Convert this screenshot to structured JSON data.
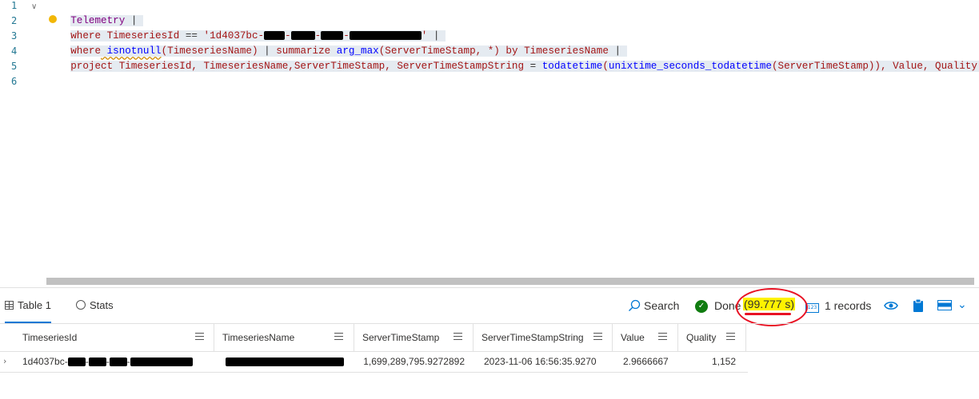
{
  "editor": {
    "line_numbers": [
      "1",
      "2",
      "3",
      "4",
      "5",
      "6"
    ],
    "lines": {
      "l1_table": "Telemetry",
      "l1_pipe": " |",
      "l2_where": "where",
      "l2_field": " TimeseriesId",
      "l2_op": " ==",
      "l2_str_start": " '1d4037bc-",
      "l2_str_end": "'",
      "l2_pipe": " |",
      "l3_where": "where",
      "l3_fn": " isnotnull",
      "l3_arg": "(TimeseriesName)",
      "l3_pipe": " |",
      "l3_summarize": " summarize",
      "l3_fn2": " arg_max",
      "l3_args": "(ServerTimeStamp, *)",
      "l3_by": " by",
      "l3_byfield": " TimeseriesName",
      "l3_pipe2": " |",
      "l4_project": "project",
      "l4_rest_a": " TimeseriesId, TimeseriesName,ServerTimeStamp, ServerTimeStampString",
      "l4_eq": " =",
      "l4_fn": " todatetime",
      "l4_paren": "(",
      "l4_fn2": "unixtime_seconds_todatetime",
      "l4_arg": "(ServerTimeStamp)),",
      "l4_rest_b": " Value, Quality"
    }
  },
  "results": {
    "tabs": [
      "Table 1",
      "Stats"
    ],
    "search_label": "Search",
    "status_label": "Done",
    "elapsed": "(99.777 s)",
    "records": "1 records",
    "columns": [
      "TimeseriesId",
      "TimeseriesName",
      "ServerTimeStamp",
      "ServerTimeStampString",
      "Value",
      "Quality"
    ],
    "row": {
      "timeseries_id_prefix": "1d4037bc-",
      "server_timestamp": "1,699,289,795.9272892",
      "server_timestamp_string": "2023-11-06 16:56:35.9270",
      "value": "2.9666667",
      "quality": "1,152"
    }
  },
  "colors": {
    "accent": "#0078d4",
    "done": "#107c10",
    "highlight": "#fff200",
    "annotation": "#e81123"
  },
  "icons": [
    "chevron-down-icon",
    "lightbulb-icon",
    "table-icon",
    "stats-icon",
    "search-icon",
    "check-circle-icon",
    "number-type-icon",
    "eye-icon",
    "clipboard-icon",
    "layout-icon",
    "column-menu-icon",
    "row-expand-icon"
  ]
}
